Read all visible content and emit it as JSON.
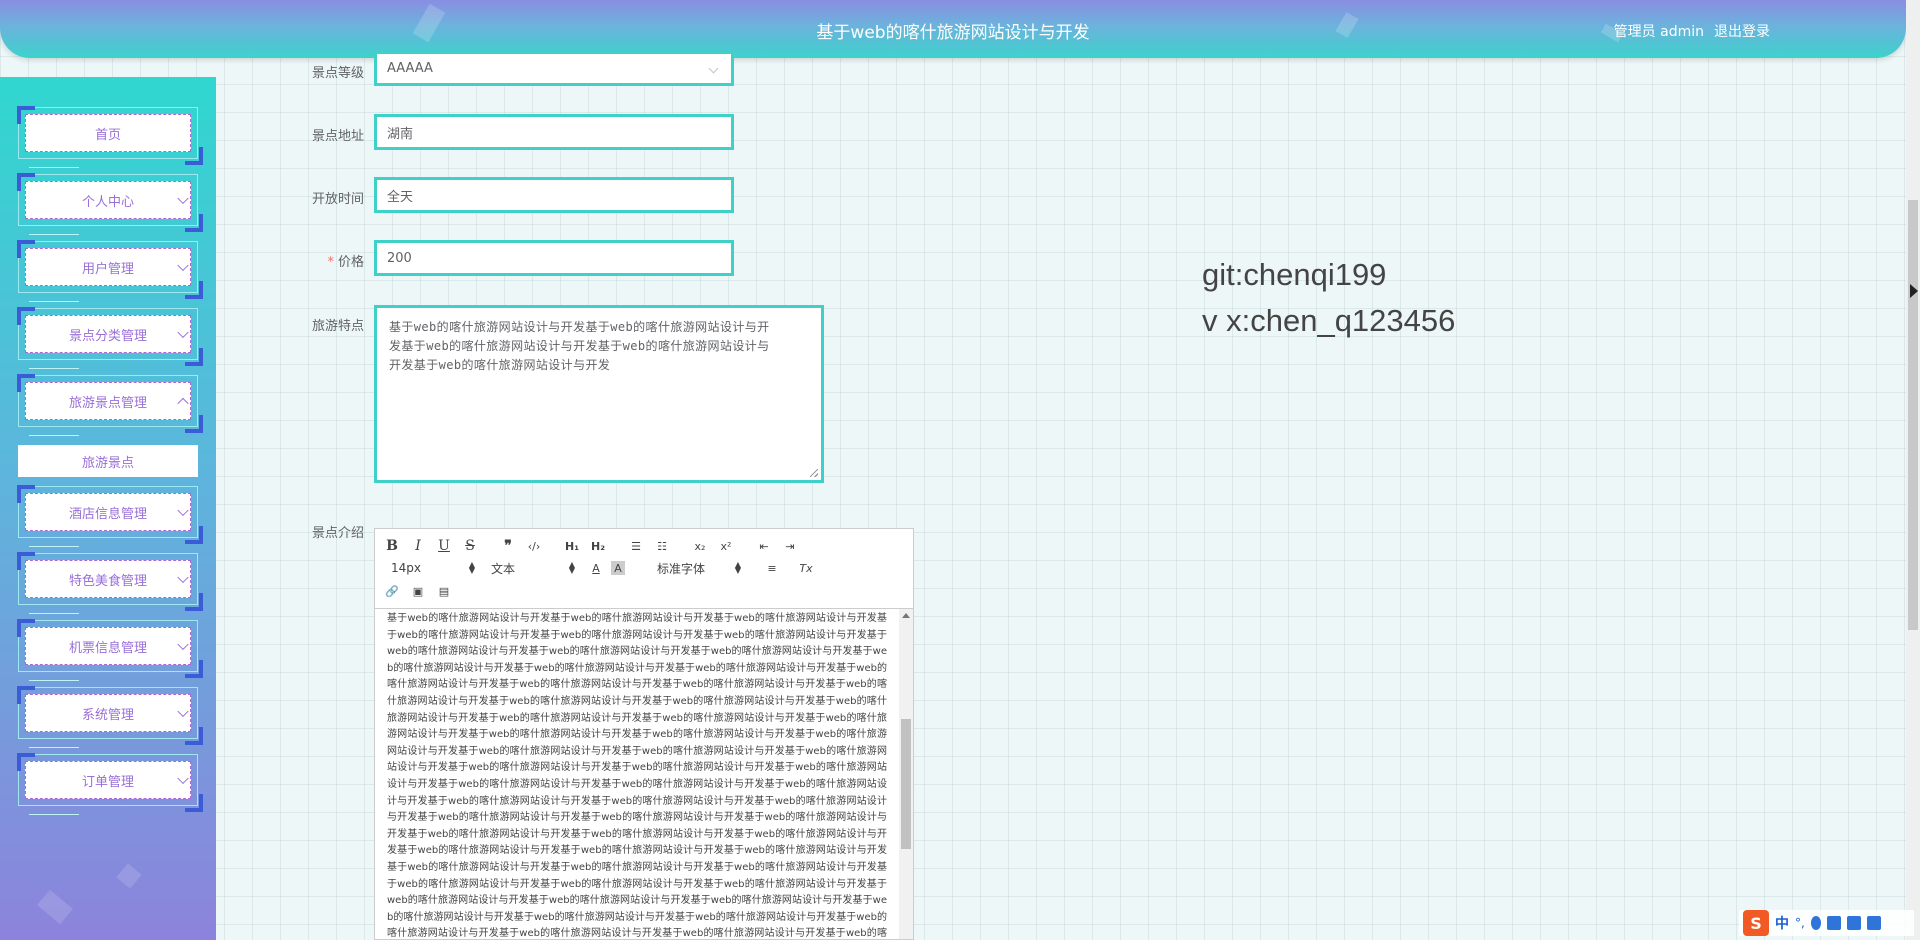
{
  "header": {
    "title": "基于web的喀什旅游网站设计与开发",
    "user": "管理员 admin",
    "logout": "退出登录"
  },
  "sidebar": {
    "items": [
      {
        "label": "首页",
        "has_chevron": false
      },
      {
        "label": "个人中心",
        "has_chevron": true
      },
      {
        "label": "用户管理",
        "has_chevron": true
      },
      {
        "label": "景点分类管理",
        "has_chevron": true
      },
      {
        "label": "旅游景点管理",
        "has_chevron": true,
        "expanded": true
      },
      {
        "label": "酒店信息管理",
        "has_chevron": true
      },
      {
        "label": "特色美食管理",
        "has_chevron": true
      },
      {
        "label": "机票信息管理",
        "has_chevron": true
      },
      {
        "label": "系统管理",
        "has_chevron": true
      },
      {
        "label": "订单管理",
        "has_chevron": true
      }
    ],
    "submenu": {
      "label": "旅游景点"
    }
  },
  "form": {
    "level": {
      "label": "景点等级",
      "value": "AAAAA"
    },
    "address": {
      "label": "景点地址",
      "value": "湖南"
    },
    "open_time": {
      "label": "开放时间",
      "value": "全天"
    },
    "price": {
      "label": "价格",
      "required_mark": "*",
      "value": "200"
    },
    "features": {
      "label": "旅游特点",
      "lines": [
        "基于web的喀什旅游网站设计与开发基于web的喀什旅游网站设计与开",
        "发基于web的喀什旅游网站设计与开发基于web的喀什旅游网站设计与",
        "开发基于web的喀什旅游网站设计与开发"
      ]
    },
    "intro": {
      "label": "景点介绍",
      "toolbar": {
        "font_size": "14px",
        "text_type": "文本",
        "font_family": "标准字体"
      },
      "content": "基于web的喀什旅游网站设计与开发基于web的喀什旅游网站设计与开发基于web的喀什旅游网站设计与开发基于web的喀什旅游网站设计与开发基于web的喀什旅游网站设计与开发基于web的喀什旅游网站设计与开发基于web的喀什旅游网站设计与开发基于web的喀什旅游网站设计与开发基于web的喀什旅游网站设计与开发基于web的喀什旅游网站设计与开发基于web的喀什旅游网站设计与开发基于web的喀什旅游网站设计与开发基于web的喀什旅游网站设计与开发基于web的喀什旅游网站设计与开发基于web的喀什旅游网站设计与开发基于web的喀什旅游网站设计与开发基于web的喀什旅游网站设计与开发基于web的喀什旅游网站设计与开发基于web的喀什旅游网站设计与开发基于web的喀什旅游网站设计与开发基于web的喀什旅游网站设计与开发基于web的喀什旅游网站设计与开发基于web的喀什旅游网站设计与开发基于web的喀什旅游网站设计与开发基于web的喀什旅游网站设计与开发基于web的喀什旅游网站设计与开发基于web的喀什旅游网站设计与开发基于web的喀什旅游网站设计与开发基于web的喀什旅游网站设计与开发基于web的喀什旅游网站设计与开发基于web的喀什旅游网站设计与开发基于web的喀什旅游网站设计与开发基于web的喀什旅游网站设计与开发基于web的喀什旅游网站设计与开发基于web的喀什旅游网站设计与开发基于web的喀什旅游网站设计与开发基于web的喀什旅游网站设计与开发基于web的喀什旅游网站设计与开发基于web的喀什旅游网站设计与开发基于web的喀什旅游网站设计与开发基于web的喀什旅游网站设计与开发基于web的喀什旅游网站设计与开发基于web的喀什旅游网站设计与开发基于web的喀什旅游网站设计与开发基于web的喀什旅游网站设计与开发基于web的喀什旅游网站设计与开发基于web的喀什旅游网站设计与开发基于web的喀什旅游网站设计与开发基于web的喀什旅游网站设计与开发基于web的喀什旅游网站设计与开发基于web的喀什旅游网站设计与开发基于web的喀什旅游网站设计与开发基于web的喀什旅游网站设计与开发基于web的喀什旅游网站设计与开发基于web的喀什旅游网站设计与开发基于web的喀什旅游网站设计与开发基于web的喀什旅游网站设计与开发基于web的喀什旅游网站设计与开发基于web的喀什旅游网站设计与开发基于web的喀什旅游网站设计与开发基于web的喀什旅游网站设计与开发基于web的喀什旅"
    }
  },
  "watermark": {
    "line1": "git:chenqi199",
    "line2": "v x:chen_q123456"
  },
  "ime": {
    "logo": "S",
    "lang": "中",
    "punct": "°,"
  },
  "colors": {
    "accent": "#3fd0c8",
    "menu_text": "#9a6fd8",
    "corner": "#3c5bd6"
  }
}
